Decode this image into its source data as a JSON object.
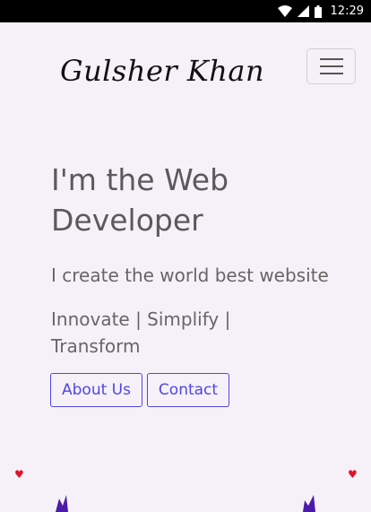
{
  "status_bar": {
    "time": "12:29",
    "icons": [
      "wifi-icon",
      "signal-icon",
      "battery-icon"
    ]
  },
  "header": {
    "brand": "Gulsher Khan",
    "menu_icon": "hamburger-menu-icon"
  },
  "hero": {
    "title": "I'm the Web Developer",
    "subtitle": "I create the world best website",
    "tagline": "Innovate | Simplify | Transform"
  },
  "buttons": {
    "about": "About Us",
    "contact": "Contact"
  },
  "colors": {
    "background": "#f6f1f8",
    "accent": "#4f46e5",
    "heart": "#e0102a",
    "decor": "#4b1aa8"
  }
}
